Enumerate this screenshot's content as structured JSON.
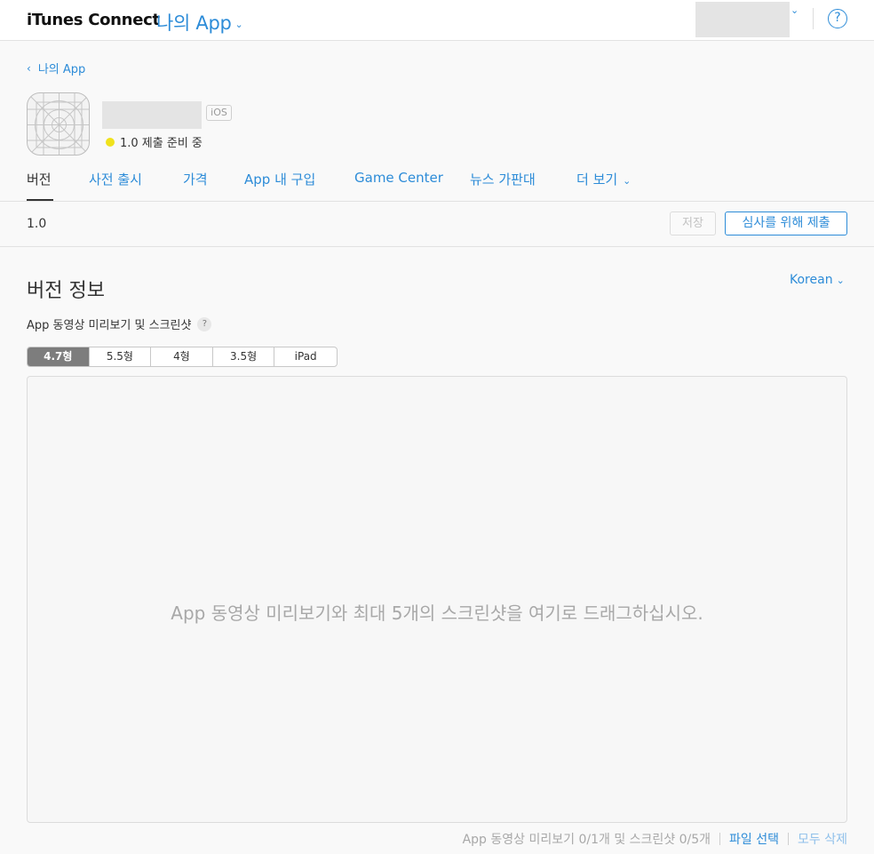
{
  "header": {
    "brand": "iTunes Connect",
    "app_menu": "나의 App",
    "help": "?"
  },
  "breadcrumb": {
    "back_label": "나의 App"
  },
  "app": {
    "platform_badge": "iOS",
    "status": "1.0 제출 준비 중",
    "status_color": "#f0e21c"
  },
  "tabs": [
    {
      "label": "버전"
    },
    {
      "label": "사전 출시"
    },
    {
      "label": "가격"
    },
    {
      "label": "App 내 구입"
    },
    {
      "label": "Game Center"
    },
    {
      "label": "뉴스 가판대"
    },
    {
      "label": "더 보기"
    }
  ],
  "toolbar": {
    "version": "1.0",
    "save_label": "저장",
    "submit_label": "심사를 위해 제출"
  },
  "section": {
    "title": "버전 정보",
    "language": "Korean",
    "media_label": "App 동영상 미리보기 및 스크린샷",
    "help": "?"
  },
  "device_tabs": [
    {
      "label": "4.7형",
      "active": true
    },
    {
      "label": "5.5형"
    },
    {
      "label": "4형"
    },
    {
      "label": "3.5형"
    },
    {
      "label": "iPad"
    }
  ],
  "dropzone": {
    "hint": "App 동영상 미리보기와 최대 5개의 스크린샷을 여기로 드래그하십시오."
  },
  "footer": {
    "count": "App 동영상 미리보기 0/1개 및 스크린샷 0/5개",
    "choose_file": "파일 선택",
    "delete_all": "모두 삭제"
  },
  "colors": {
    "accent": "#2d8cd8",
    "text": "#333333",
    "background": "#f9f9f9"
  }
}
